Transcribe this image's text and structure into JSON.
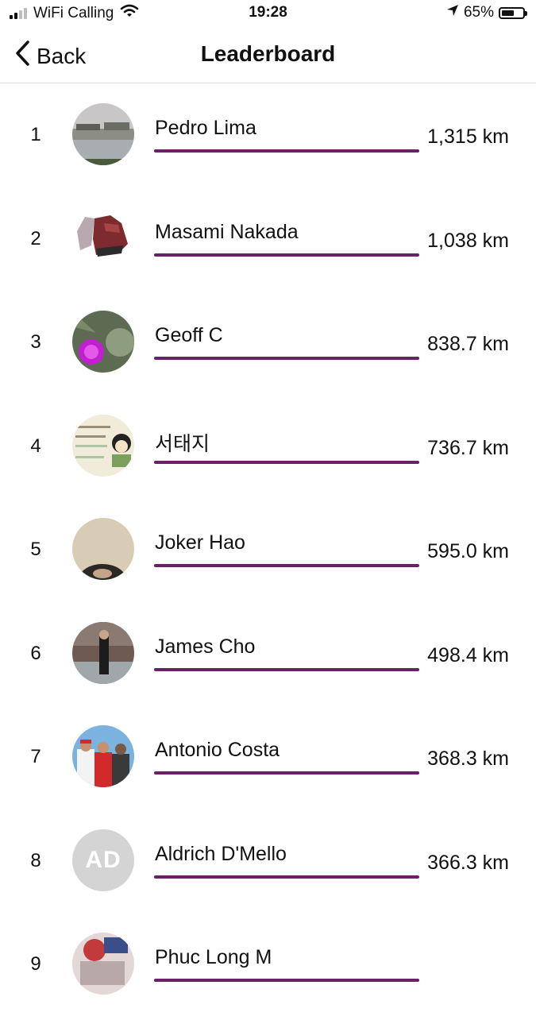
{
  "status_bar": {
    "carrier": "WiFi Calling",
    "time": "19:28",
    "battery": "65%",
    "battery_level": 0.65,
    "signal_bars": 2,
    "icons": [
      "signal-icon",
      "wifi-icon",
      "location-arrow-icon",
      "battery-icon"
    ]
  },
  "nav": {
    "back_label": "Back",
    "title": "Leaderboard",
    "icons": [
      "chevron-left-icon"
    ]
  },
  "accent_color": "#6a2168",
  "entries": [
    {
      "rank": "1",
      "name": "Pedro Lima",
      "distance": "1,315 km",
      "progress": 1.0,
      "avatar": "lake-photo"
    },
    {
      "rank": "2",
      "name": "Masami Nakada",
      "distance": "1,038 km",
      "progress": 1.0,
      "avatar": "sneakers-photo"
    },
    {
      "rank": "3",
      "name": "Geoff C",
      "distance": "838.7 km",
      "progress": 1.0,
      "avatar": "thistle-photo"
    },
    {
      "rank": "4",
      "name": "서태지",
      "distance": "736.7 km",
      "progress": 1.0,
      "avatar": "id-card-photo"
    },
    {
      "rank": "5",
      "name": "Joker Hao",
      "distance": "595.0 km",
      "progress": 1.0,
      "avatar": "head-photo"
    },
    {
      "rank": "6",
      "name": "James Cho",
      "distance": "498.4 km",
      "progress": 1.0,
      "avatar": "street-photo"
    },
    {
      "rank": "7",
      "name": "Antonio Costa",
      "distance": "368.3 km",
      "progress": 1.0,
      "avatar": "group-photo"
    },
    {
      "rank": "8",
      "name": "Aldrich D'Mello",
      "distance": "366.3 km",
      "progress": 1.0,
      "avatar": "initials",
      "initials": "AD"
    },
    {
      "rank": "9",
      "name": "Phuc Long M",
      "distance": "",
      "progress": 1.0,
      "avatar": "partial-photo"
    }
  ]
}
